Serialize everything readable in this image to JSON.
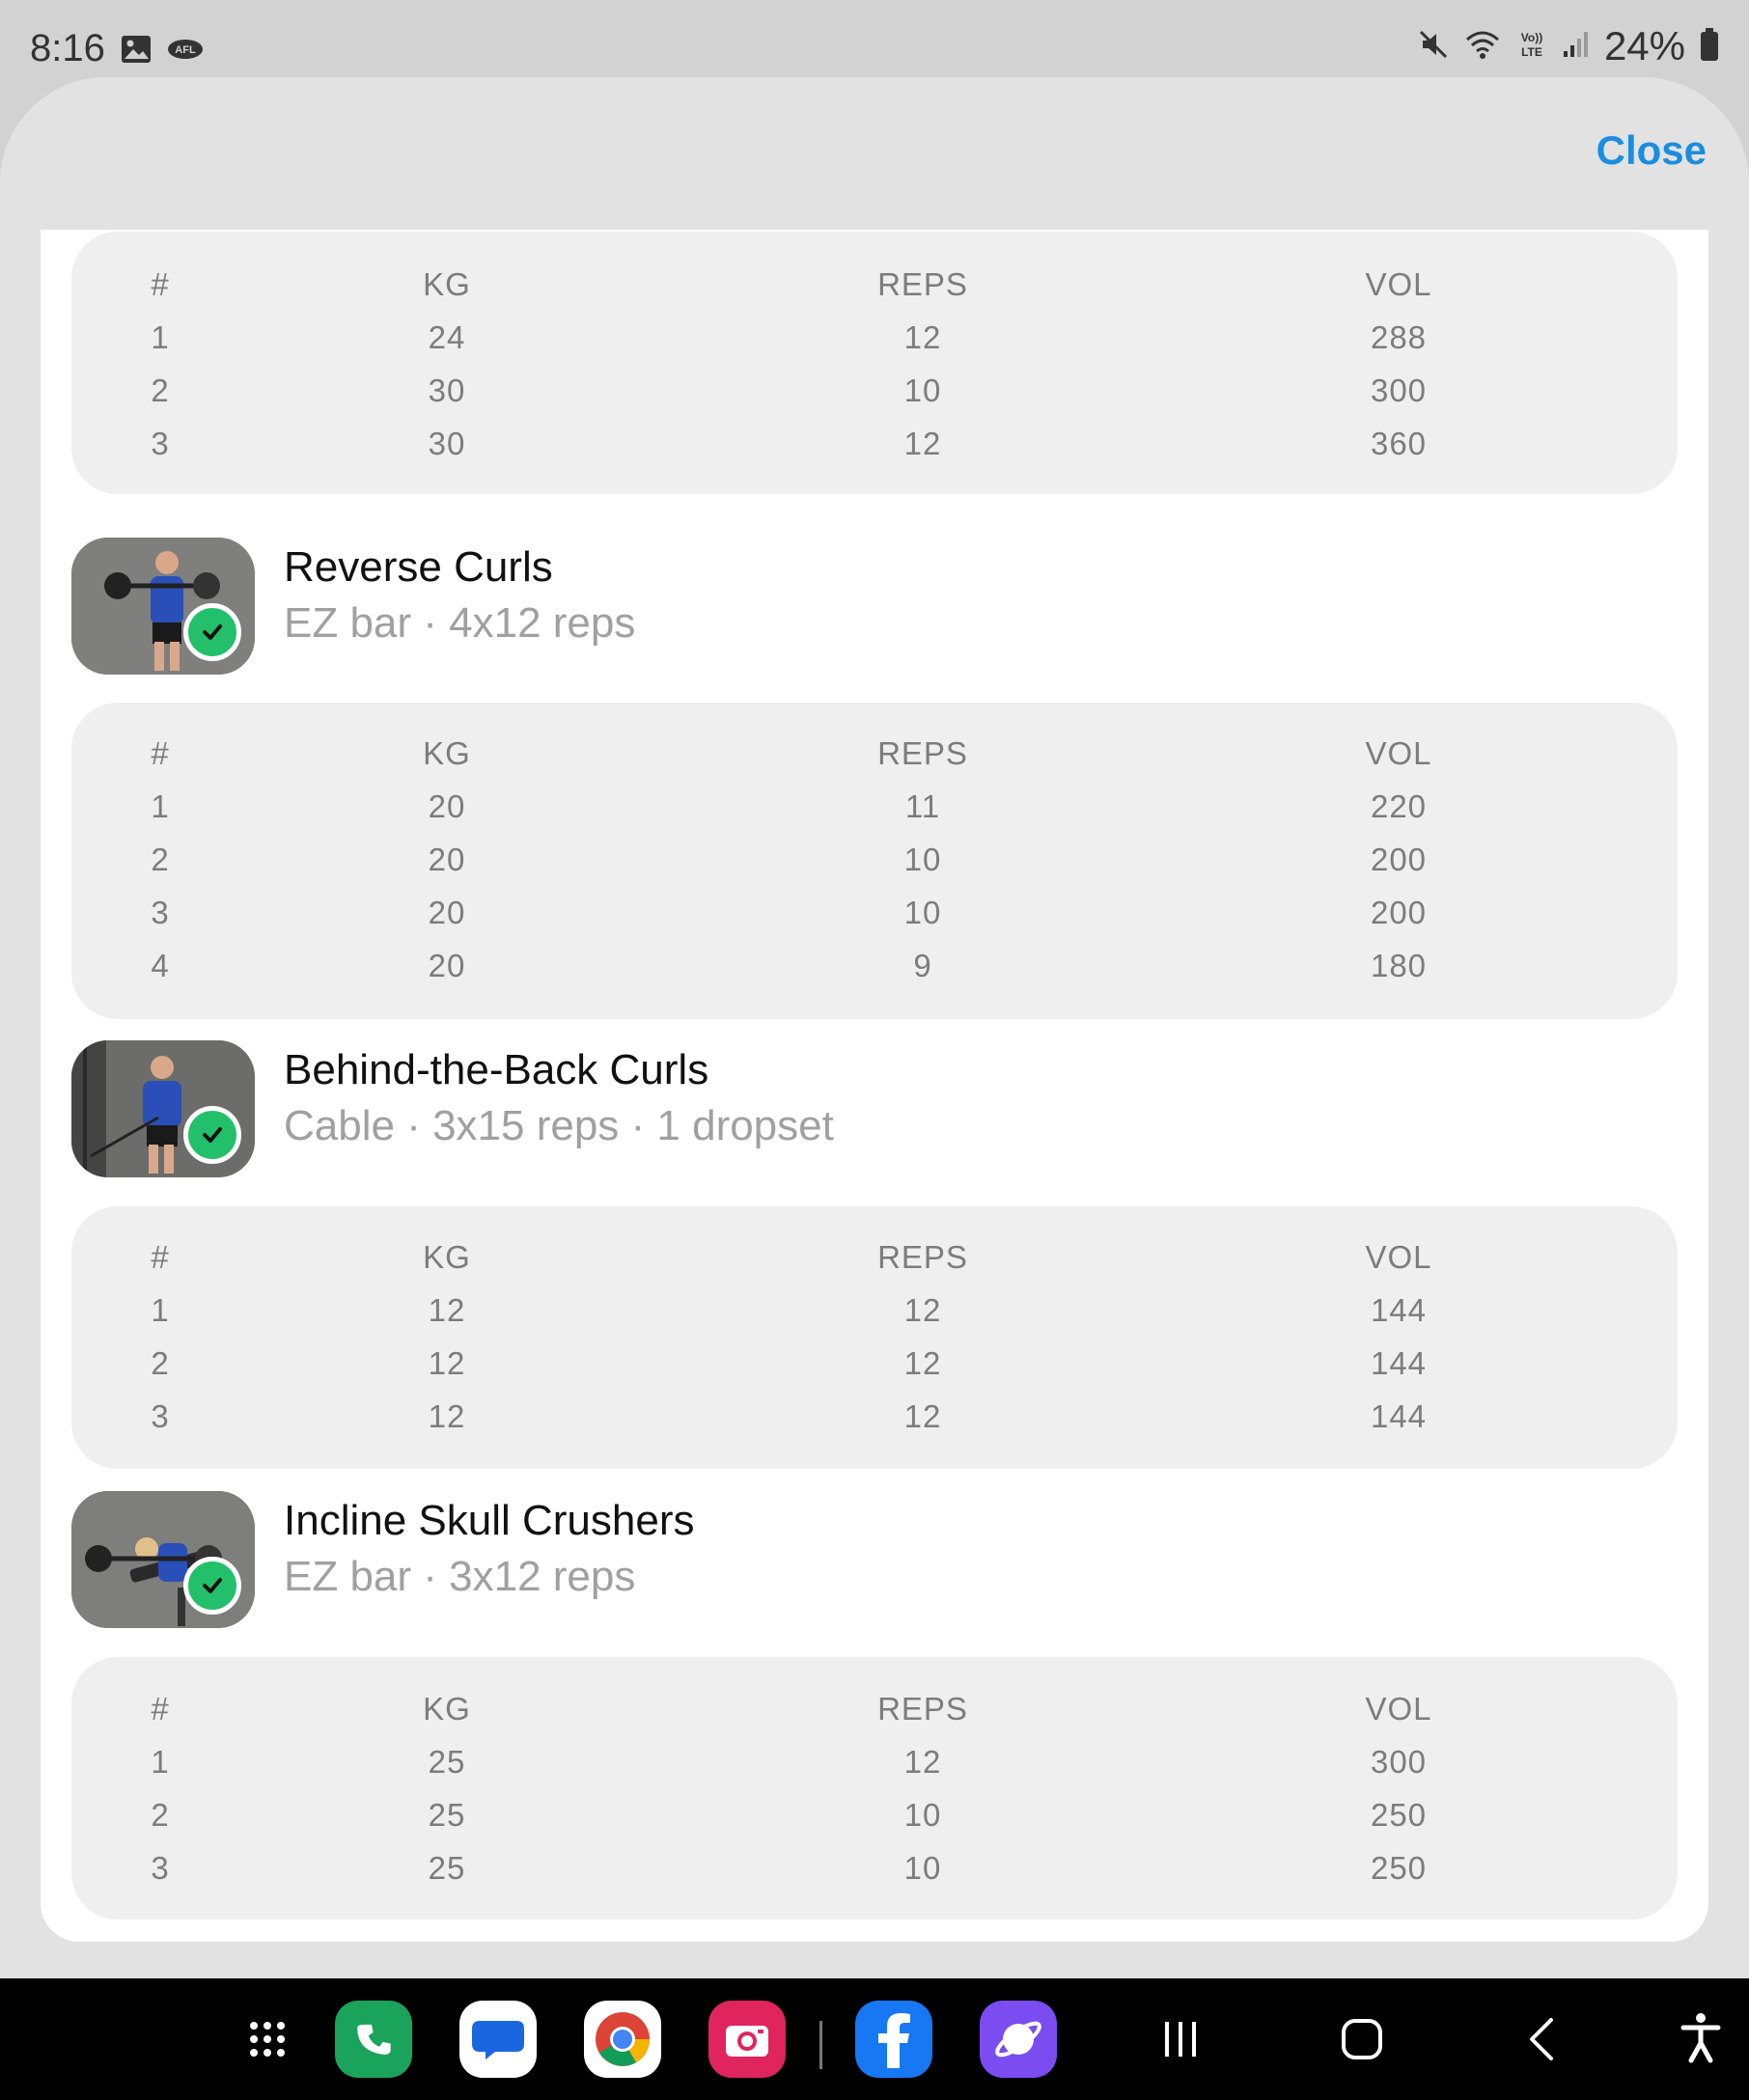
{
  "status_bar": {
    "time": "8:16",
    "left_icons": [
      "image-icon",
      "afl-icon"
    ],
    "right_icons": [
      "mute-icon",
      "wifi-icon",
      "volte-icon",
      "signal-icon",
      "battery-icon"
    ],
    "volte_text": "Vo)) LTE",
    "afl_text": "AFL",
    "battery": "24%"
  },
  "header": {
    "close_label": "Close"
  },
  "table_headers": {
    "num": "#",
    "kg": "KG",
    "reps": "REPS",
    "vol": "VOL"
  },
  "exercises": [
    {
      "title": "",
      "subtitle": "",
      "sets": [
        {
          "num": "1",
          "kg": "24",
          "reps": "12",
          "vol": "288"
        },
        {
          "num": "2",
          "kg": "30",
          "reps": "10",
          "vol": "300"
        },
        {
          "num": "3",
          "kg": "30",
          "reps": "12",
          "vol": "360"
        }
      ]
    },
    {
      "title": "Reverse Curls",
      "subtitle": "EZ bar · 4x12 reps",
      "completed": true,
      "sets": [
        {
          "num": "1",
          "kg": "20",
          "reps": "11",
          "vol": "220"
        },
        {
          "num": "2",
          "kg": "20",
          "reps": "10",
          "vol": "200"
        },
        {
          "num": "3",
          "kg": "20",
          "reps": "10",
          "vol": "200"
        },
        {
          "num": "4",
          "kg": "20",
          "reps": "9",
          "vol": "180"
        }
      ]
    },
    {
      "title": "Behind-the-Back Curls",
      "subtitle": "Cable · 3x15 reps · 1 dropset",
      "completed": true,
      "sets": [
        {
          "num": "1",
          "kg": "12",
          "reps": "12",
          "vol": "144"
        },
        {
          "num": "2",
          "kg": "12",
          "reps": "12",
          "vol": "144"
        },
        {
          "num": "3",
          "kg": "12",
          "reps": "12",
          "vol": "144"
        }
      ]
    },
    {
      "title": "Incline Skull Crushers",
      "subtitle": "EZ bar · 3x12 reps",
      "completed": true,
      "sets": [
        {
          "num": "1",
          "kg": "25",
          "reps": "12",
          "vol": "300"
        },
        {
          "num": "2",
          "kg": "25",
          "reps": "10",
          "vol": "250"
        },
        {
          "num": "3",
          "kg": "25",
          "reps": "10",
          "vol": "250"
        }
      ]
    }
  ],
  "nav_bar": {
    "apps": [
      "app-drawer-icon",
      "phone-app-icon",
      "messages-app-icon",
      "chrome-app-icon",
      "camera-app-icon",
      "facebook-app-icon",
      "internet-app-icon"
    ],
    "buttons": [
      "recents-icon",
      "home-icon",
      "back-icon",
      "accessibility-icon"
    ]
  },
  "colors": {
    "accent": "#1a8de0",
    "check": "#22c06a",
    "sheet_bg": "#e2e2e2",
    "table_bg": "#efefef"
  }
}
